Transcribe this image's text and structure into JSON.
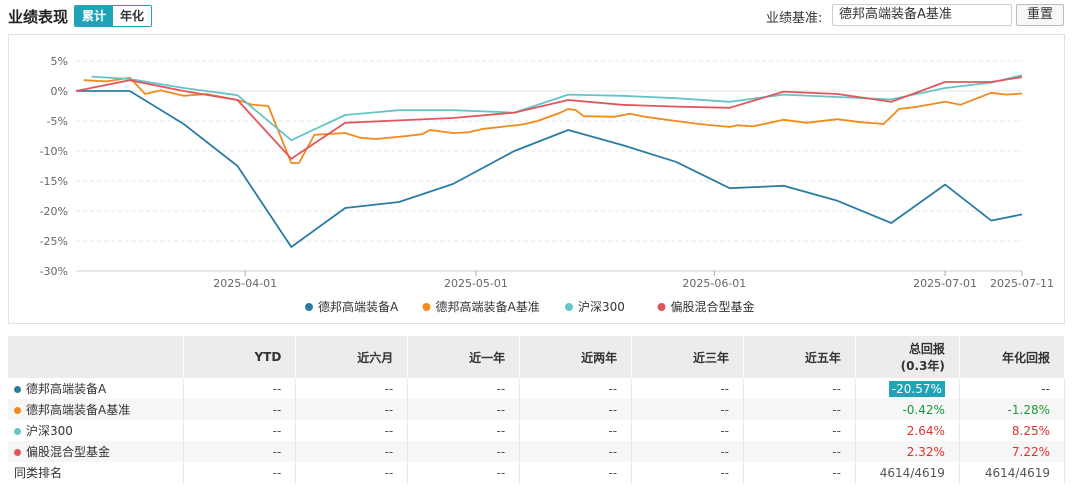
{
  "header": {
    "title": "业绩表现",
    "toggle": [
      "累计",
      "年化"
    ],
    "toggle_active": 0,
    "benchmark_label": "业绩基准:",
    "benchmark_value": "德邦高端装备A基准",
    "reset_label": "重置"
  },
  "chart_data": {
    "type": "line",
    "ylim": [
      -30,
      5
    ],
    "yticks": [
      "5%",
      "0%",
      "-5%",
      "-10%",
      "-15%",
      "-20%",
      "-25%",
      "-30%"
    ],
    "xticks": [
      "2025-04-01",
      "2025-05-01",
      "2025-06-01",
      "2025-07-01",
      "2025-07-11"
    ],
    "x_range": [
      "2025-03-10",
      "2025-07-11"
    ],
    "grid": true,
    "legend_position": "bottom",
    "series": [
      {
        "name": "德邦高端装备A",
        "color": "#2b7ca3",
        "points": [
          [
            "2025-03-10",
            0
          ],
          [
            "2025-03-13",
            0
          ],
          [
            "2025-03-17",
            0
          ],
          [
            "2025-03-24",
            -5.5
          ],
          [
            "2025-03-31",
            -12.5
          ],
          [
            "2025-04-07",
            -26
          ],
          [
            "2025-04-14",
            -19.5
          ],
          [
            "2025-04-21",
            -18.5
          ],
          [
            "2025-04-28",
            -15.5
          ],
          [
            "2025-05-06",
            -10
          ],
          [
            "2025-05-13",
            -6.5
          ],
          [
            "2025-05-20",
            -9
          ],
          [
            "2025-05-27",
            -11.8
          ],
          [
            "2025-06-03",
            -16.2
          ],
          [
            "2025-06-10",
            -15.8
          ],
          [
            "2025-06-17",
            -18.3
          ],
          [
            "2025-06-24",
            -22
          ],
          [
            "2025-07-01",
            -15.6
          ],
          [
            "2025-07-07",
            -21.6
          ],
          [
            "2025-07-11",
            -20.57
          ]
        ]
      },
      {
        "name": "德邦高端装备A基准",
        "color": "#f28a1c",
        "points": [
          [
            "2025-03-11",
            1.8
          ],
          [
            "2025-03-14",
            1.6
          ],
          [
            "2025-03-17",
            2.2
          ],
          [
            "2025-03-19",
            -0.5
          ],
          [
            "2025-03-21",
            0.1
          ],
          [
            "2025-03-24",
            -0.8
          ],
          [
            "2025-03-27",
            -0.5
          ],
          [
            "2025-03-31",
            -1.5
          ],
          [
            "2025-04-02",
            -2.3
          ],
          [
            "2025-04-04",
            -2.5
          ],
          [
            "2025-04-07",
            -12
          ],
          [
            "2025-04-08",
            -12
          ],
          [
            "2025-04-10",
            -7.3
          ],
          [
            "2025-04-14",
            -7
          ],
          [
            "2025-04-16",
            -7.8
          ],
          [
            "2025-04-18",
            -8
          ],
          [
            "2025-04-22",
            -7.5
          ],
          [
            "2025-04-24",
            -7.2
          ],
          [
            "2025-04-25",
            -6.5
          ],
          [
            "2025-04-28",
            -7
          ],
          [
            "2025-04-30",
            -6.9
          ],
          [
            "2025-05-02",
            -6.3
          ],
          [
            "2025-05-07",
            -5.6
          ],
          [
            "2025-05-09",
            -5
          ],
          [
            "2025-05-12",
            -3.6
          ],
          [
            "2025-05-13",
            -3.0
          ],
          [
            "2025-05-14",
            -3.2
          ],
          [
            "2025-05-15",
            -4.2
          ],
          [
            "2025-05-19",
            -4.3
          ],
          [
            "2025-05-21",
            -3.8
          ],
          [
            "2025-05-23",
            -4.3
          ],
          [
            "2025-05-27",
            -5
          ],
          [
            "2025-05-30",
            -5.5
          ],
          [
            "2025-06-03",
            -6
          ],
          [
            "2025-06-04",
            -5.7
          ],
          [
            "2025-06-06",
            -5.9
          ],
          [
            "2025-06-10",
            -4.8
          ],
          [
            "2025-06-13",
            -5.3
          ],
          [
            "2025-06-17",
            -4.7
          ],
          [
            "2025-06-20",
            -5.2
          ],
          [
            "2025-06-23",
            -5.5
          ],
          [
            "2025-06-25",
            -3
          ],
          [
            "2025-06-27",
            -2.7
          ],
          [
            "2025-07-01",
            -1.8
          ],
          [
            "2025-07-03",
            -2.3
          ],
          [
            "2025-07-07",
            -0.3
          ],
          [
            "2025-07-09",
            -0.6
          ],
          [
            "2025-07-11",
            -0.42
          ]
        ]
      },
      {
        "name": "沪深300",
        "color": "#66c3c6",
        "points": [
          [
            "2025-03-12",
            2.4
          ],
          [
            "2025-03-17",
            2
          ],
          [
            "2025-03-24",
            0.5
          ],
          [
            "2025-03-31",
            -0.7
          ],
          [
            "2025-04-07",
            -8.2
          ],
          [
            "2025-04-14",
            -4
          ],
          [
            "2025-04-21",
            -3.2
          ],
          [
            "2025-04-28",
            -3.2
          ],
          [
            "2025-05-06",
            -3.6
          ],
          [
            "2025-05-13",
            -0.6
          ],
          [
            "2025-05-20",
            -0.8
          ],
          [
            "2025-05-27",
            -1.2
          ],
          [
            "2025-06-03",
            -1.8
          ],
          [
            "2025-06-10",
            -0.6
          ],
          [
            "2025-06-17",
            -1
          ],
          [
            "2025-06-24",
            -1.4
          ],
          [
            "2025-07-01",
            0.5
          ],
          [
            "2025-07-07",
            1.4
          ],
          [
            "2025-07-11",
            2.64
          ]
        ]
      },
      {
        "name": "偏股混合型基金",
        "color": "#e2565b",
        "points": [
          [
            "2025-03-10",
            0
          ],
          [
            "2025-03-17",
            1.8
          ],
          [
            "2025-03-24",
            0
          ],
          [
            "2025-03-31",
            -1.5
          ],
          [
            "2025-04-07",
            -11.3
          ],
          [
            "2025-04-14",
            -5.3
          ],
          [
            "2025-04-21",
            -4.9
          ],
          [
            "2025-04-28",
            -4.5
          ],
          [
            "2025-05-06",
            -3.6
          ],
          [
            "2025-05-13",
            -1.5
          ],
          [
            "2025-05-20",
            -2.3
          ],
          [
            "2025-05-27",
            -2.6
          ],
          [
            "2025-06-03",
            -2.8
          ],
          [
            "2025-06-10",
            -0.1
          ],
          [
            "2025-06-17",
            -0.5
          ],
          [
            "2025-06-24",
            -1.8
          ],
          [
            "2025-07-01",
            1.5
          ],
          [
            "2025-07-07",
            1.5
          ],
          [
            "2025-07-11",
            2.32
          ]
        ]
      }
    ]
  },
  "table": {
    "headers": [
      "",
      "YTD",
      "近六月",
      "近一年",
      "近两年",
      "近三年",
      "近五年",
      "总回报\n(0.3年)",
      "年化回报"
    ],
    "rows": [
      {
        "name": "德邦高端装备A",
        "color": "#2b7ca3",
        "cells": [
          "--",
          "--",
          "--",
          "--",
          "--",
          "--",
          "-20.57%",
          "--"
        ],
        "cls": [
          "",
          "",
          "",
          "",
          "",
          "",
          "hl",
          ""
        ]
      },
      {
        "name": "德邦高端装备A基准",
        "color": "#f28a1c",
        "cells": [
          "--",
          "--",
          "--",
          "--",
          "--",
          "--",
          "-0.42%",
          "-1.28%"
        ],
        "cls": [
          "",
          "",
          "",
          "",
          "",
          "",
          "neg",
          "neg"
        ]
      },
      {
        "name": "沪深300",
        "color": "#66c3c6",
        "cells": [
          "--",
          "--",
          "--",
          "--",
          "--",
          "--",
          "2.64%",
          "8.25%"
        ],
        "cls": [
          "",
          "",
          "",
          "",
          "",
          "",
          "pos",
          "pos"
        ]
      },
      {
        "name": "偏股混合型基金",
        "color": "#e2565b",
        "cells": [
          "--",
          "--",
          "--",
          "--",
          "--",
          "--",
          "2.32%",
          "7.22%"
        ],
        "cls": [
          "",
          "",
          "",
          "",
          "",
          "",
          "pos",
          "pos"
        ]
      },
      {
        "name": "同类排名",
        "color": "",
        "cells": [
          "--",
          "--",
          "--",
          "--",
          "--",
          "--",
          "4614/4619",
          "4614/4619"
        ],
        "cls": [
          "",
          "",
          "",
          "",
          "",
          "",
          "",
          ""
        ]
      }
    ]
  }
}
